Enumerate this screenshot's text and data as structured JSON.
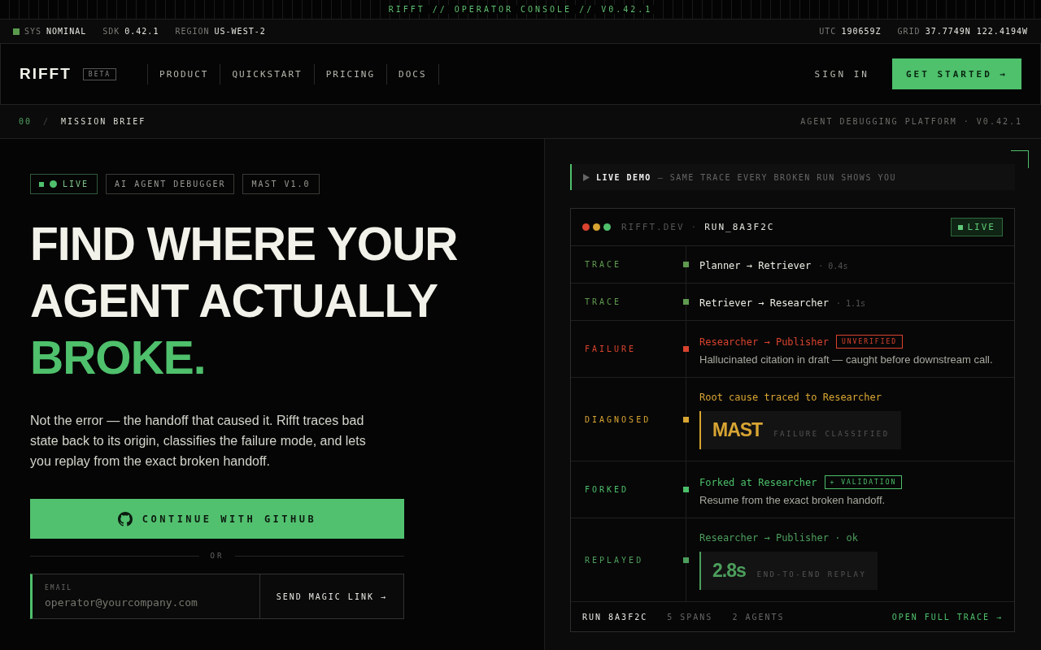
{
  "banner": "RIFFT // OPERATOR CONSOLE // V0.42.1",
  "status_bar": {
    "left": [
      {
        "label": "SYS",
        "value": "NOMINAL"
      },
      {
        "label": "SDK",
        "value": "0.42.1"
      },
      {
        "label": "REGION",
        "value": "US-WEST-2"
      }
    ],
    "right": [
      {
        "label": "UTC",
        "value": "190659Z"
      },
      {
        "label": "GRID",
        "value": "37.7749N 122.4194W"
      }
    ]
  },
  "nav": {
    "logo": "RIFFT",
    "badge": "BETA",
    "links": [
      "PRODUCT",
      "QUICKSTART",
      "PRICING",
      "DOCS"
    ],
    "sign_in": "SIGN IN",
    "cta": "GET STARTED →"
  },
  "breadcrumb": {
    "index": "00",
    "separator": "/",
    "title": "MISSION BRIEF",
    "meta": "AGENT DEBUGGING PLATFORM · V0.42.1"
  },
  "hero": {
    "tags": [
      {
        "kind": "live",
        "label": "LIVE"
      },
      {
        "kind": "plain",
        "label": "AI AGENT DEBUGGER"
      },
      {
        "kind": "plain",
        "label": "MAST V1.0"
      }
    ],
    "headline_lines": [
      "FIND WHERE YOUR",
      "AGENT ACTUALLY"
    ],
    "headline_accent": "BROKE.",
    "body": "Not the error — the handoff that caused it. Rifft traces bad state back to its origin, classifies the failure mode, and lets you replay from the exact broken handoff.",
    "github_button": "CONTINUE WITH GITHUB",
    "divider": "OR",
    "email": {
      "label": "EMAIL",
      "placeholder": "operator@yourcompany.com"
    },
    "magic_link": "SEND MAGIC LINK →"
  },
  "demo": {
    "title": "LIVE DEMO",
    "subtitle": "— SAME TRACE EVERY BROKEN RUN SHOWS YOU",
    "window": {
      "host": "RIFFT.DEV",
      "separator": "·",
      "run": "RUN_8A3F2C",
      "status": "LIVE"
    },
    "rows": [
      {
        "kind": "trace",
        "label": "TRACE",
        "color": "#5f9a4f",
        "title": "Planner → Retriever",
        "duration": "· 0.4s"
      },
      {
        "kind": "trace",
        "label": "TRACE",
        "color": "#5f9a4f",
        "title": "Retriever → Researcher",
        "duration": "· 1.1s"
      },
      {
        "kind": "failure",
        "label": "FAILURE",
        "color": "#d9432f",
        "title": "Researcher → Publisher",
        "tag": "UNVERIFIED",
        "description": "Hallucinated citation in draft — caught before downstream call."
      },
      {
        "kind": "diagnosed",
        "label": "DIAGNOSED",
        "color": "#d8a533",
        "title": "Root cause traced to Researcher",
        "metric": {
          "value": "MAST",
          "label": "FAILURE CLASSIFIED"
        }
      },
      {
        "kind": "forked",
        "label": "FORKED",
        "color": "#4cbf6a",
        "title": "Forked at Researcher",
        "tag": "+ VALIDATION",
        "description": "Resume from the exact broken handoff."
      },
      {
        "kind": "replayed",
        "label": "REPLAYED",
        "color": "#4c9e5c",
        "title": "Researcher → Publisher · ok",
        "metric": {
          "value": "2.8s",
          "label": "END-TO-END REPLAY"
        }
      }
    ],
    "footer": {
      "run": "RUN 8A3F2C",
      "spans": "5 SPANS",
      "agents": "2 AGENTS",
      "link": "OPEN FULL TRACE →"
    }
  }
}
